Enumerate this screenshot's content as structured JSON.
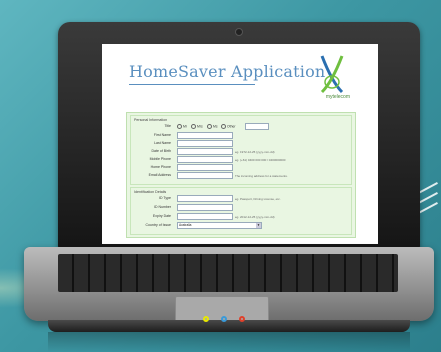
{
  "app": {
    "title": "HomeSaver Application",
    "brand_name": "mytelecom"
  },
  "colors": {
    "background": "#3d97a3",
    "title_blue": "#5a8fbf",
    "form_bg": "#e9f6e2",
    "brand_green": "#6fbf3f",
    "brand_blue": "#2a6fb0"
  },
  "personal": {
    "legend": "Personal Information",
    "title_label": "Title",
    "title_options": [
      "Mr",
      "Mrs",
      "Ms",
      "Other"
    ],
    "first_name_label": "First Name",
    "last_name_label": "Last Name",
    "dob_label": "Date of Birth",
    "dob_hint": "eg. 1972-12-25 (yyyy-mm-dd)",
    "mobile_label": "Mobile Phone",
    "mobile_hint": "eg. (+61) 0400 000 000 / 0400000000",
    "home_label": "Home Phone",
    "email_label": "Email Address",
    "email_hint": "The incoming address for a statements."
  },
  "identification": {
    "legend": "Identification Details",
    "id_type_label": "ID Type",
    "id_type_hint": "eg. Passport, Driving License, etc.",
    "id_number_label": "ID Number",
    "expiry_label": "Expiry Date",
    "expiry_hint": "eg. 2012-12-25 (yyyy-mm-dd)",
    "country_label": "Country of Issue",
    "country_value": "Australia"
  },
  "ports": {
    "colors": [
      "#e8e800",
      "#3a9ad9",
      "#e0402a"
    ]
  }
}
